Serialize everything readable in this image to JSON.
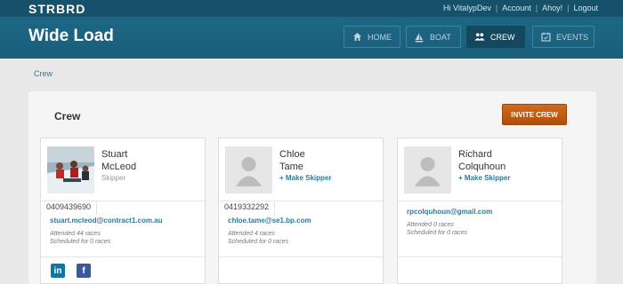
{
  "topbar": {
    "logo": "STRBRD",
    "links": [
      "Hi VitalypDev",
      "Account",
      "Ahoy!",
      "Logout"
    ]
  },
  "header": {
    "boat_name": "Wide Load",
    "nav": [
      {
        "label": "HOME",
        "icon": "home-icon",
        "active": false
      },
      {
        "label": "BOAT",
        "icon": "sailboat-icon",
        "active": false
      },
      {
        "label": "CREW",
        "icon": "people-icon",
        "active": true
      },
      {
        "label": "EVENTS",
        "icon": "calendar-icon",
        "active": false
      }
    ]
  },
  "breadcrumb": "Crew",
  "main": {
    "title": "Crew",
    "invite_button": "INVITE CREW",
    "crew": [
      {
        "first_name": "Stuart",
        "last_name": "McLeod",
        "role": "Skipper",
        "phone": "0409439690",
        "email": "stuart.mcleod@contract1.com.au",
        "attended": "Attended 44 races",
        "scheduled": "Scheduled for 0 races",
        "social": [
          "in",
          "f"
        ]
      },
      {
        "first_name": "Chloe",
        "last_name": "Tame",
        "action": "+ Make Skipper",
        "phone": "0419332292",
        "email": "chloe.tame@se1.bp.com",
        "attended": "Attended 4 races",
        "scheduled": "Scheduled for 0 races"
      },
      {
        "first_name": "Richard",
        "last_name": "Colquhoun",
        "action": "+ Make Skipper",
        "email": "rpcolquhoun@gmail.com",
        "attended": "Attended 0 races",
        "scheduled": "Scheduled for 0 races"
      }
    ]
  },
  "colors": {
    "header": "#1d6a88",
    "accent_button": "#c45e17",
    "link": "#2b7a9b"
  }
}
